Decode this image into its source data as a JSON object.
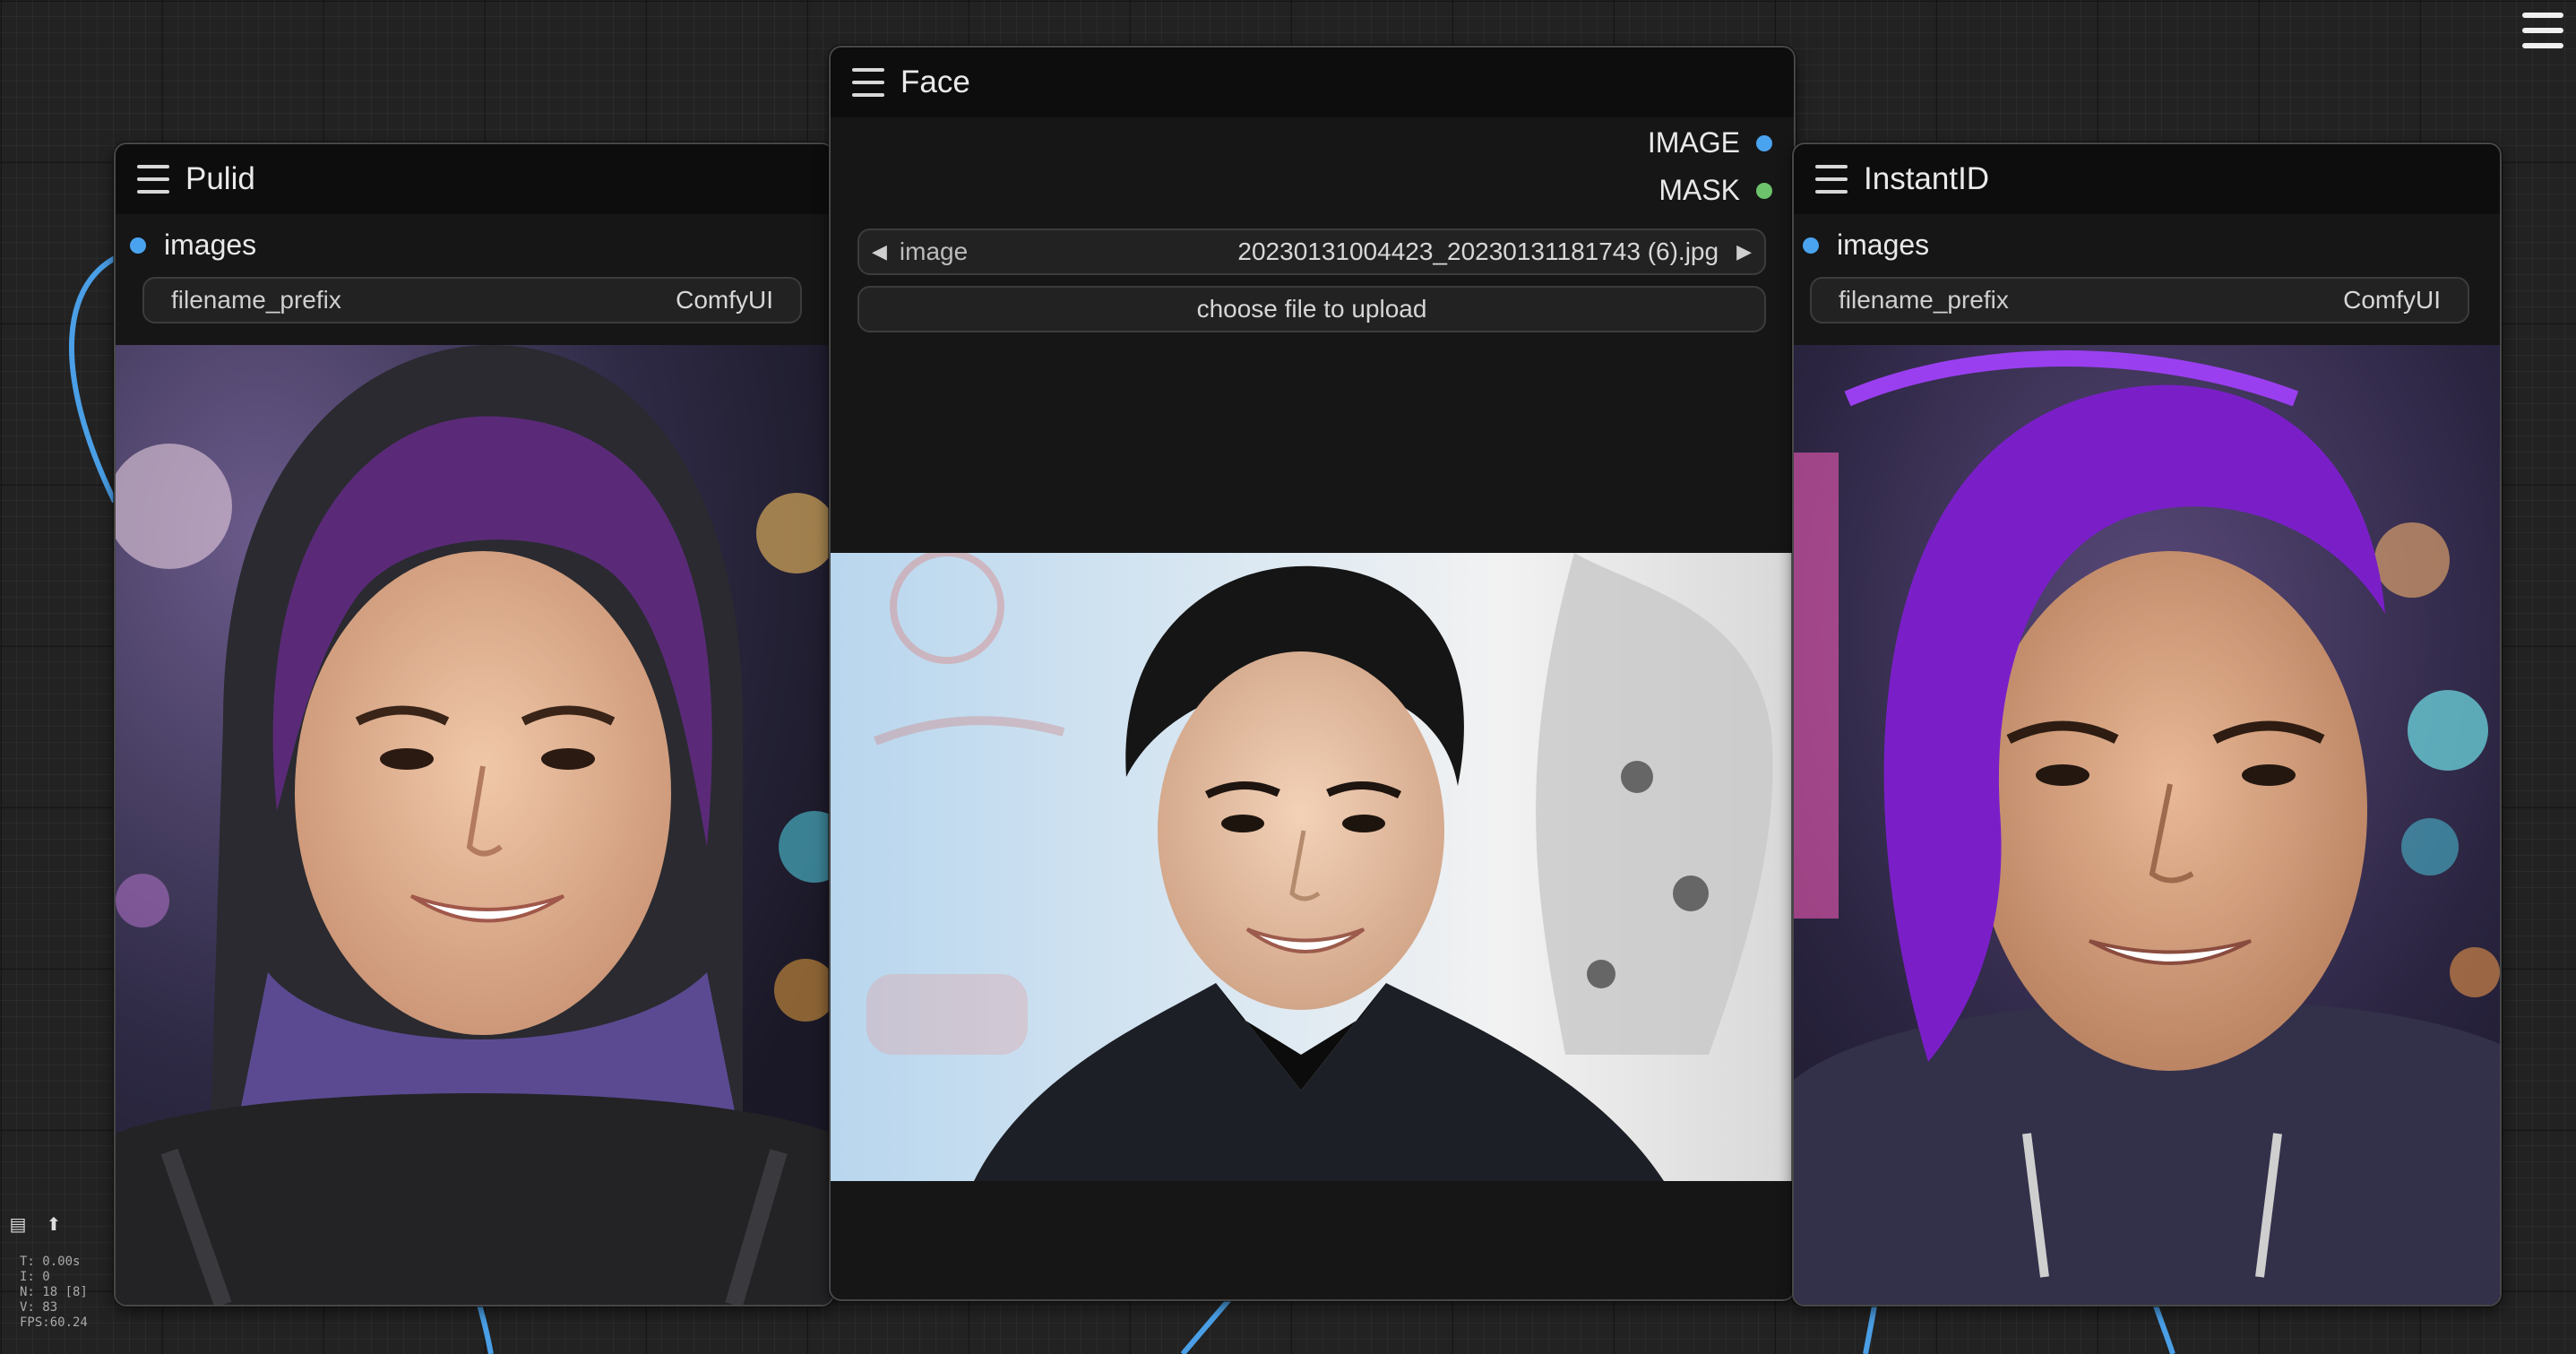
{
  "nodes": {
    "pulid": {
      "title": "Pulid",
      "input_slot": "images",
      "widget_name": "filename_prefix",
      "widget_value": "ComfyUI"
    },
    "face": {
      "title": "Face",
      "outputs": [
        "IMAGE",
        "MASK"
      ],
      "combo_label": "image",
      "combo_value": "20230131004423_20230131181743 (6).jpg",
      "upload_button": "choose file to upload"
    },
    "instantid": {
      "title": "InstantID",
      "input_slot": "images",
      "widget_name": "filename_prefix",
      "widget_value": "ComfyUI"
    }
  },
  "stats": [
    "T: 0.00s",
    "I: 0",
    "N: 18 [8]",
    "V: 83",
    "FPS:60.24"
  ],
  "colors": {
    "image_port": "#4aa3ef",
    "mask_port": "#6cc36c",
    "link": "#4a9fe6"
  },
  "icons": {
    "node_menu": "hamburger-icon",
    "canvas_menu": "hamburger-icon"
  }
}
